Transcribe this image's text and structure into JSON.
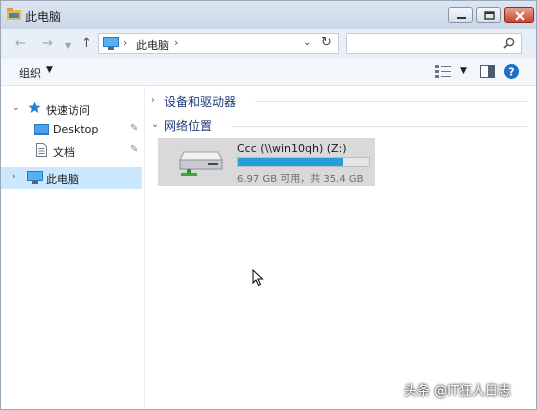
{
  "window": {
    "title": "此电脑"
  },
  "address": {
    "location": "此电脑",
    "search_placeholder": ""
  },
  "toolbar": {
    "organize_label": "组织"
  },
  "nav": {
    "quick_access": "快速访问",
    "desktop": "Desktop",
    "documents": "文档",
    "this_pc": "此电脑"
  },
  "content": {
    "groups": [
      {
        "label": "设备和驱动器",
        "expanded": false
      },
      {
        "label": "网络位置",
        "expanded": true
      }
    ],
    "drive": {
      "name": "Ccc (\\\\win10qh) (Z:)",
      "free_text": "6.97 GB 可用，共 35.4 GB",
      "used_fraction": 0.803
    }
  },
  "watermark": {
    "text": "头条 @IT狂人日志"
  },
  "colors": {
    "accent": "#26a0da",
    "selection": "#cce8ff",
    "group_header": "#1e3a78",
    "close_button": "#c8442e"
  },
  "icons": [
    "folder-icon",
    "minimize-icon",
    "maximize-icon",
    "close-icon",
    "back-icon",
    "forward-icon",
    "up-icon",
    "computer-icon",
    "refresh-icon",
    "search-icon",
    "view-icon",
    "preview-pane-icon",
    "help-icon",
    "star-icon",
    "desktop-icon",
    "document-icon",
    "pin-icon",
    "network-drive-icon",
    "cursor-icon"
  ]
}
